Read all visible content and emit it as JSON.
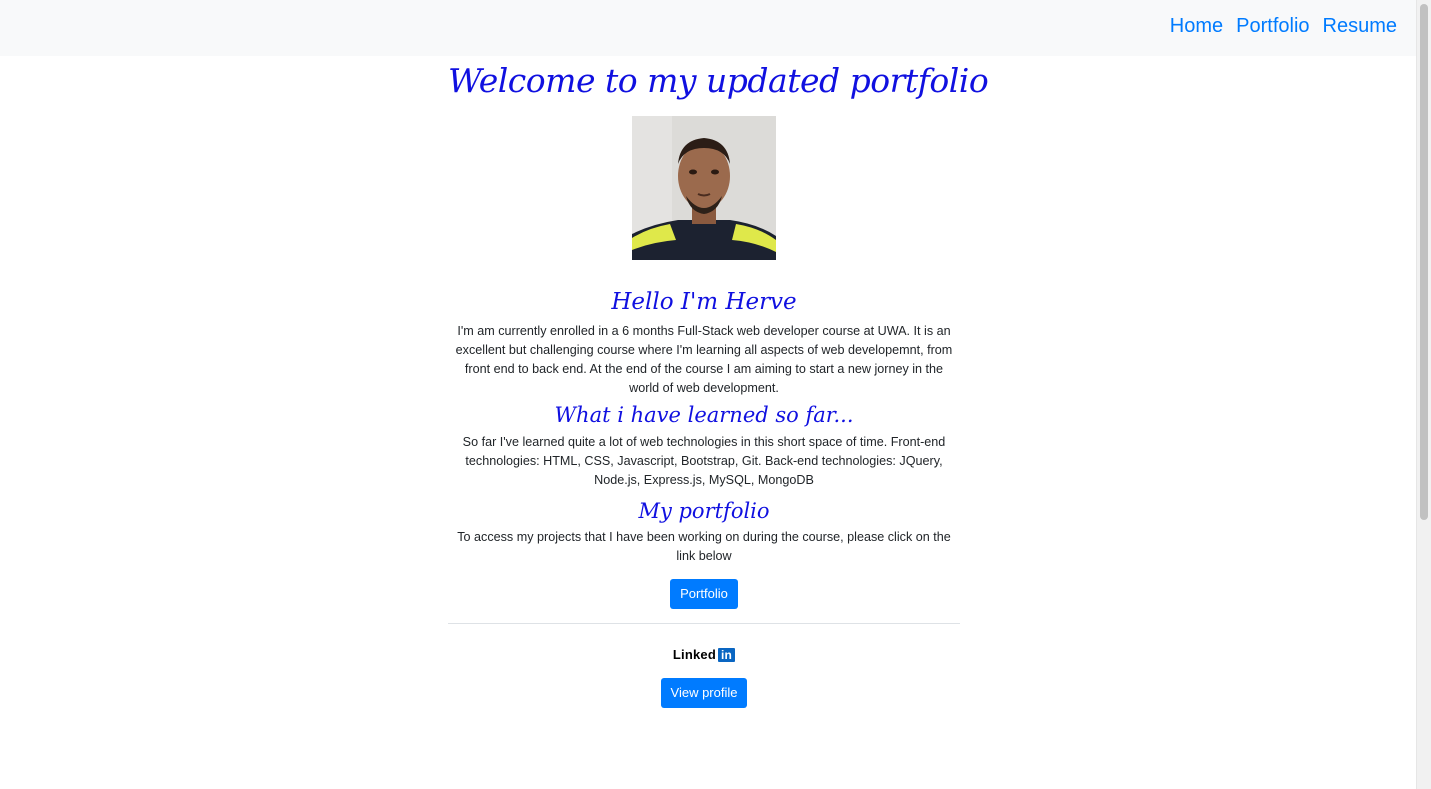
{
  "nav": {
    "links": [
      "Home",
      "Portfolio",
      "Resume"
    ]
  },
  "main": {
    "title": "Welcome to my updated portfolio",
    "hello_heading": "Hello I'm Herve",
    "intro_text": "I'm am currently enrolled in a 6 months Full-Stack web developer course at UWA. It is an excellent but challenging course where I'm learning all aspects of web developemnt, from front end to back end. At the end of the course I am aiming to start a new jorney in the world of web development.",
    "learned_heading": "What i have learned so far...",
    "learned_text": "So far I've learned quite a lot of web technologies in this short space of time. Front-end technologies: HTML, CSS, Javascript, Bootstrap, Git. Back-end technologies: JQuery, Node.js, Express.js, MySQL, MongoDB",
    "portfolio_heading": "My portfolio",
    "portfolio_text": "To access my projects that I have been working on during the course, please click on the link below",
    "portfolio_button": "Portfolio"
  },
  "linkedin": {
    "logo_text": "Linked",
    "logo_badge": "in",
    "button": "View profile"
  },
  "colors": {
    "accent": "#007bff",
    "heading": "#1010e0",
    "navbar_bg": "#f8f9fa"
  }
}
